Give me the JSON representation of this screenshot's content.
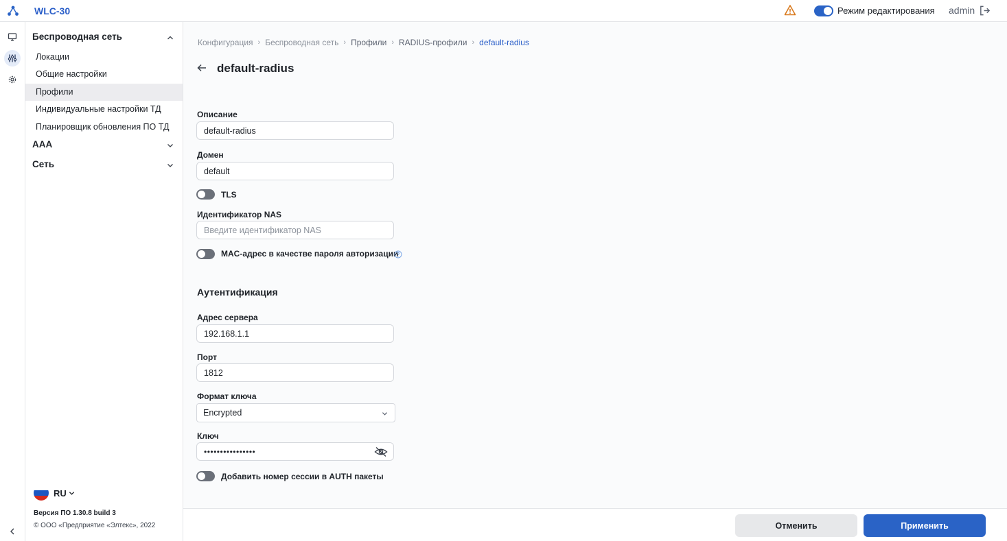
{
  "app": {
    "name": "WLC-30"
  },
  "topbar": {
    "edit_mode_label": "Режим редактирования",
    "edit_mode_on": true,
    "user": "admin"
  },
  "sidebar": {
    "groups": [
      {
        "label": "Беспроводная сеть",
        "expanded": true,
        "items": [
          {
            "label": "Локации"
          },
          {
            "label": "Общие настройки"
          },
          {
            "label": "Профили",
            "active": true
          },
          {
            "label": "Индивидуальные настройки ТД"
          },
          {
            "label": "Планировщик обновления ПО ТД"
          }
        ]
      },
      {
        "label": "AAA",
        "expanded": false
      },
      {
        "label": "Сеть",
        "expanded": false
      }
    ],
    "language": "RU",
    "version": "Версия ПО 1.30.8 build 3",
    "copyright": "© ООО «Предприятие «Элтекс», 2022"
  },
  "breadcrumb": [
    "Конфигурация",
    "Беспроводная сеть",
    "Профили",
    "RADIUS-профили",
    "default-radius"
  ],
  "page": {
    "title": "default-radius"
  },
  "form": {
    "description": {
      "label": "Описание",
      "value": "default-radius"
    },
    "domain": {
      "label": "Домен",
      "value": "default"
    },
    "tls": {
      "label": "TLS",
      "on": false
    },
    "nas_id": {
      "label": "Идентификатор NAS",
      "value": "",
      "placeholder": "Введите идентификатор NAS"
    },
    "mac_password": {
      "label": "MAC-адрес в качестве пароля авторизации",
      "on": false
    },
    "auth_section": "Аутентификация",
    "server": {
      "label": "Адрес сервера",
      "value": "192.168.1.1"
    },
    "port": {
      "label": "Порт",
      "value": "1812"
    },
    "key_format": {
      "label": "Формат ключа",
      "value": "Encrypted"
    },
    "key": {
      "label": "Ключ",
      "masked": "••••••••••••••••"
    },
    "session_number": {
      "label": "Добавить номер сессии в AUTH пакеты",
      "on": false
    }
  },
  "footer": {
    "cancel_label": "Отменить",
    "apply_label": "Применить"
  },
  "colors": {
    "accent": "#2a63c6",
    "warning": "#d97a1e",
    "toggle_off": "#6b7079"
  }
}
